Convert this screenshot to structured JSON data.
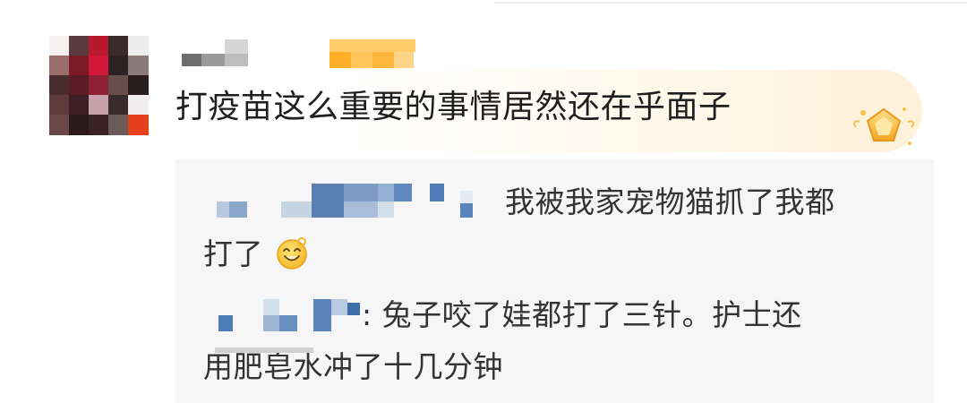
{
  "main_comment": {
    "text": "打疫苗这么重要的事情居然还在乎面子",
    "badge_icon": "pentagon-star-badge-icon"
  },
  "replies": [
    {
      "line1": "我被我家宠物猫抓了我都",
      "line2": "打了",
      "emoji_icon": "smile-emoji-icon"
    },
    {
      "line1": ": 兔子咬了娃都打了三针。护士还",
      "line2": "用肥皂水冲了十几分钟"
    }
  ],
  "colors": {
    "reply_background": "#f6f6f6",
    "mosaic_blue": "#5b8cc9",
    "mosaic_orange": "#ffb833",
    "badge_gold": "#f5b82e"
  }
}
